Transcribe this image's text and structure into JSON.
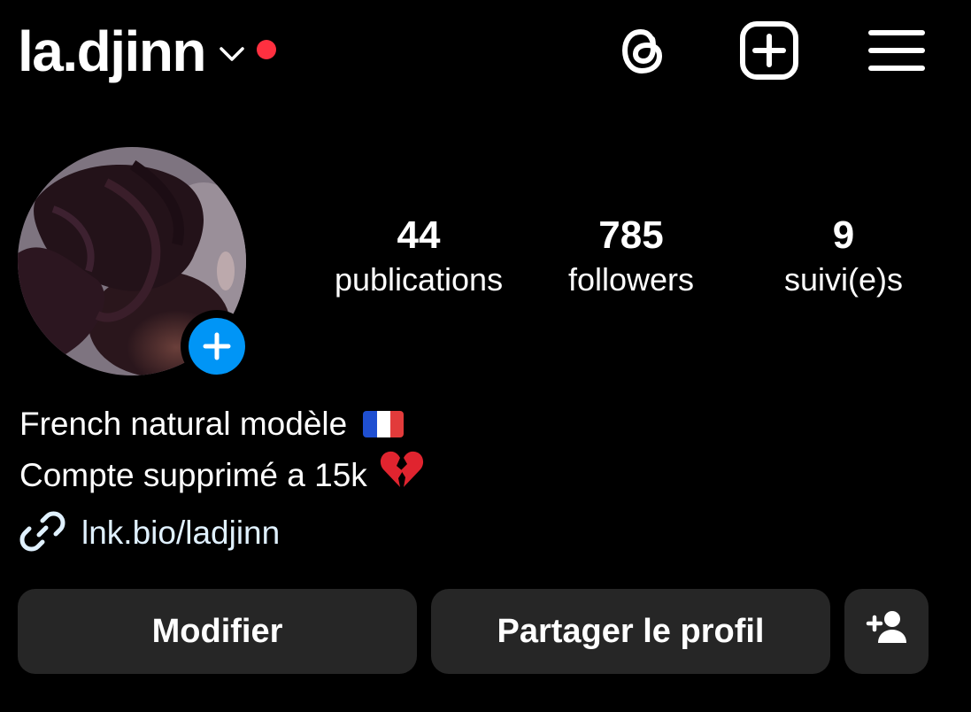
{
  "header": {
    "username": "la.djinn",
    "icons": {
      "switch_account": "chevron-down-icon",
      "threads": "threads-icon",
      "create": "plus-square-icon",
      "menu": "hamburger-menu-icon"
    }
  },
  "profile": {
    "stats": [
      {
        "value": "44",
        "label": "publications"
      },
      {
        "value": "785",
        "label": "followers"
      },
      {
        "value": "9",
        "label": "suivi(e)s"
      }
    ],
    "bio": {
      "line1": "French natural modèle",
      "line2": "Compte supprimé a 15k"
    },
    "link": "lnk.bio/ladjinn"
  },
  "buttons": {
    "edit": "Modifier",
    "share": "Partager le profil"
  },
  "colors": {
    "background": "#000000",
    "text": "#ffffff",
    "link": "#e0f1ff",
    "notification_dot": "#ff3040",
    "accent_blue": "#0095f6",
    "button_bg": "#262626"
  }
}
